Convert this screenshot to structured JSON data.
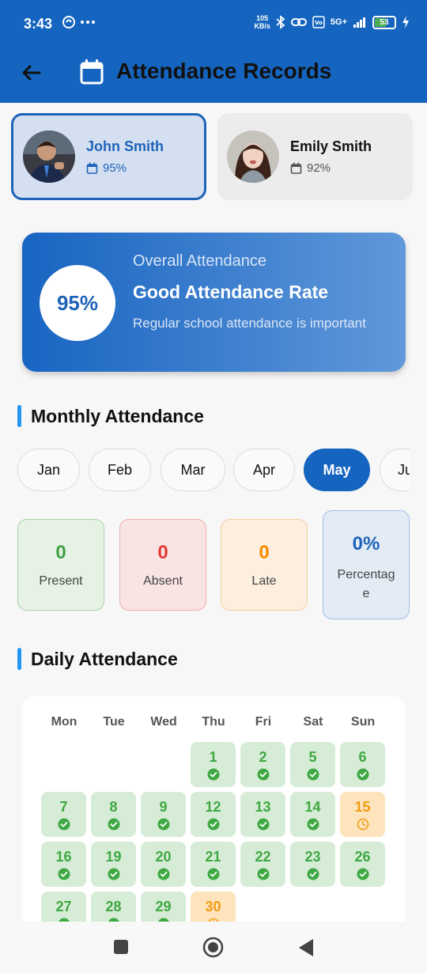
{
  "status_bar": {
    "time": "3:43",
    "speed_value": "105",
    "speed_unit": "KB/s",
    "network": "5G+",
    "battery": "53",
    "battery_level": 0.53
  },
  "app_bar": {
    "title": "Attendance Records",
    "back_icon": "arrow-left-icon",
    "title_icon": "calendar-icon",
    "color": "#1565c0"
  },
  "students": [
    {
      "name": "John Smith",
      "percent": "95%",
      "selected": true
    },
    {
      "name": "Emily Smith",
      "percent": "92%",
      "selected": false
    }
  ],
  "overall": {
    "percent": "95%",
    "label": "Overall Attendance",
    "rate": "Good Attendance Rate",
    "description": "Regular school attendance is important"
  },
  "monthly": {
    "heading": "Monthly Attendance",
    "months": [
      "Jan",
      "Feb",
      "Mar",
      "Apr",
      "May",
      "Ju"
    ],
    "selected": "May",
    "stats": [
      {
        "value": "0",
        "label": "Present",
        "color": "#43a047"
      },
      {
        "value": "0",
        "label": "Absent",
        "color": "#e53935"
      },
      {
        "value": "0",
        "label": "Late",
        "color": "#fb8c00"
      },
      {
        "value": "0%",
        "label": "Percentag\ne",
        "color": "#1e63b8"
      }
    ]
  },
  "daily": {
    "heading": "Daily Attendance",
    "weekdays": [
      "Mon",
      "Tue",
      "Wed",
      "Thu",
      "Fri",
      "Sat",
      "Sun"
    ],
    "days": [
      {
        "day": "1",
        "status": "present"
      },
      {
        "day": "2",
        "status": "present"
      },
      {
        "day": "5",
        "status": "present"
      },
      {
        "day": "6",
        "status": "present"
      },
      {
        "day": "7",
        "status": "present"
      },
      {
        "day": "8",
        "status": "present"
      },
      {
        "day": "9",
        "status": "present"
      },
      {
        "day": "12",
        "status": "present"
      },
      {
        "day": "13",
        "status": "present"
      },
      {
        "day": "14",
        "status": "present"
      },
      {
        "day": "15",
        "status": "late"
      },
      {
        "day": "16",
        "status": "present"
      },
      {
        "day": "19",
        "status": "present"
      },
      {
        "day": "20",
        "status": "present"
      },
      {
        "day": "21",
        "status": "present"
      },
      {
        "day": "22",
        "status": "present"
      },
      {
        "day": "23",
        "status": "present"
      },
      {
        "day": "26",
        "status": "present"
      },
      {
        "day": "27",
        "status": "present"
      },
      {
        "day": "28",
        "status": "present"
      },
      {
        "day": "29",
        "status": "present"
      },
      {
        "day": "30",
        "status": "late"
      }
    ],
    "present_color": "#3ea842",
    "late_color": "#f39c12"
  },
  "nav_bar": {
    "items": [
      "recents-square-icon",
      "home-circle-icon",
      "back-triangle-icon"
    ]
  }
}
